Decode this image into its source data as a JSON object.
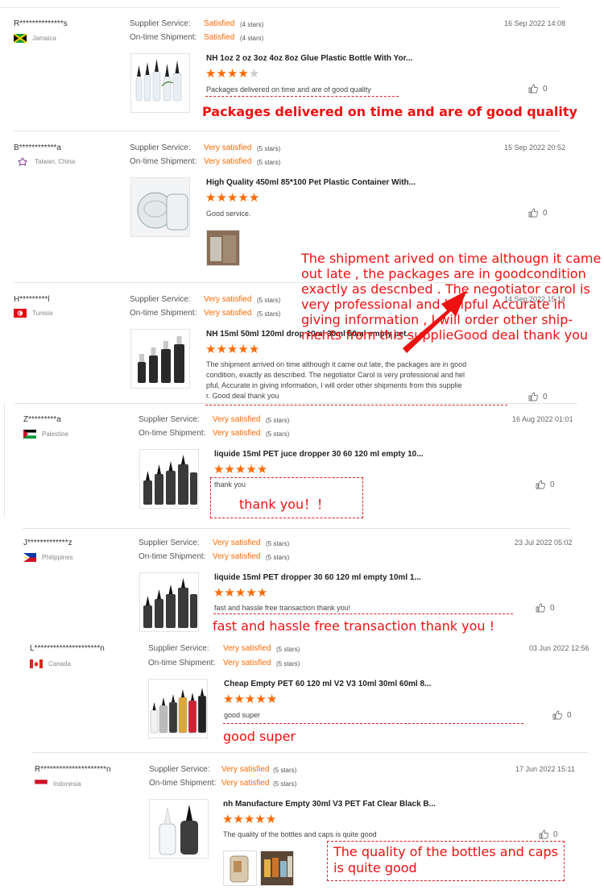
{
  "labels": {
    "supplier_service": "Supplier Service:",
    "ontime_shipment": "On-time Shipment:"
  },
  "colors": {
    "accent": "#ff6a00",
    "annotation": "#ee1111"
  },
  "reviews": [
    {
      "name": "R**************s",
      "country": "Jamaica",
      "flag": "jamaica",
      "supplier_rating": "Satisfied",
      "supplier_stars": "(4 stars)",
      "shipment_rating": "Satisfied",
      "shipment_stars": "(4 stars)",
      "date": "16 Sep 2022 14:08",
      "product": "NH 1oz 2 oz 3oz 4oz 8oz Glue Plastic Bottle With Yor...",
      "stars": 4,
      "comment": "Packages delivered on time and are of good quality",
      "likes": "0"
    },
    {
      "name": "B************a",
      "country": "Taiwan, China",
      "flag": "taiwan",
      "supplier_rating": "Very satisfied",
      "supplier_stars": "(5 stars)",
      "shipment_rating": "Very satisfied",
      "shipment_stars": "(5 stars)",
      "date": "15 Sep 2022 20:52",
      "product": "High Quality 450ml 85*100 Pet Plastic Container With...",
      "stars": 5,
      "comment": "Good service.",
      "likes": "0"
    },
    {
      "name": "H*********l",
      "country": "Tunisia",
      "flag": "tunisia",
      "supplier_rating": "Very satisfied",
      "supplier_stars": "(5 stars)",
      "shipment_rating": "Very satisfied",
      "shipment_stars": "(5 stars)",
      "date": "14 Sep 2022 15:14",
      "product": "NH 15ml 50ml 120ml drop 10ml 30ml 60ml empty pet...",
      "stars": 5,
      "comment_lines": [
        "The shipment arrived on time although it came out late, the packages are in good",
        "condition, exactly as described.  The negotiator Carol is very professional and hel",
        "pful,  Accurate in giving information, I will order other shipments from this supplie",
        "r. Good deal thank you"
      ],
      "likes": "0"
    },
    {
      "name": "Z*********a",
      "country": "Palestine",
      "flag": "palestine",
      "supplier_rating": "Very satisfied",
      "supplier_stars": "(5 stars)",
      "shipment_rating": "Very satisfied",
      "shipment_stars": "(5 stars)",
      "date": "16 Aug 2022 01:01",
      "product": "liquide 15ml PET juce dropper 30 60 120 ml empty 10...",
      "stars": 5,
      "comment": "thank you",
      "likes": "0"
    },
    {
      "name": "J*************z",
      "country": "Philippines",
      "flag": "philippines",
      "supplier_rating": "Very satisfied",
      "supplier_stars": "(5 stars)",
      "shipment_rating": "Very satisfied",
      "shipment_stars": "(5 stars)",
      "date": "23 Jul 2022 05:02",
      "product": "liquide 15ml PET dropper 30 60 120 ml empty 10ml 1...",
      "stars": 5,
      "comment": "fast and hassle free transaction thank you!",
      "likes": "0"
    },
    {
      "name": "L*********************n",
      "country": "Canada",
      "flag": "canada",
      "supplier_rating": "Very satisfied",
      "supplier_stars": "(5 stars)",
      "shipment_rating": "Very satisfied",
      "shipment_stars": "(5 stars)",
      "date": "03 Jun 2022 12:56",
      "product": "Cheap Empty PET 60 120 ml V2 V3 10ml 30ml 60ml 8...",
      "stars": 5,
      "comment": "good super",
      "likes": "0"
    },
    {
      "name": "R*********************n",
      "country": "Indonesia",
      "flag": "indonesia",
      "supplier_rating": "Very satisfied",
      "supplier_stars": "(5 stars)",
      "shipment_rating": "Very satisfied",
      "shipment_stars": "(5 stars)",
      "date": "17 Jun 2022 15:11",
      "product": "nh Manufacture Empty 30ml V3 PET Fat Clear Black B...",
      "stars": 5,
      "comment": "The quality of the bottles and caps is quite good",
      "likes": "0"
    }
  ],
  "annotations": {
    "a1": "Packages delivered on time and are of good quality",
    "a2_lines": [
      "The shipment arived on time althougn it came",
      "out late , the packages are in goodcondition",
      "exactly as descnbed . The negotiator carol is",
      "very professional and helpful Accurate in",
      "giving information , I will order other ship-",
      "ments from this supplieGood deal thank you"
    ],
    "a3": "thank you！！",
    "a4": "fast and hassle free transaction thank you !",
    "a5": "good super",
    "a6_lines": [
      "The quality of the bottles and caps",
      "is quite good"
    ]
  }
}
